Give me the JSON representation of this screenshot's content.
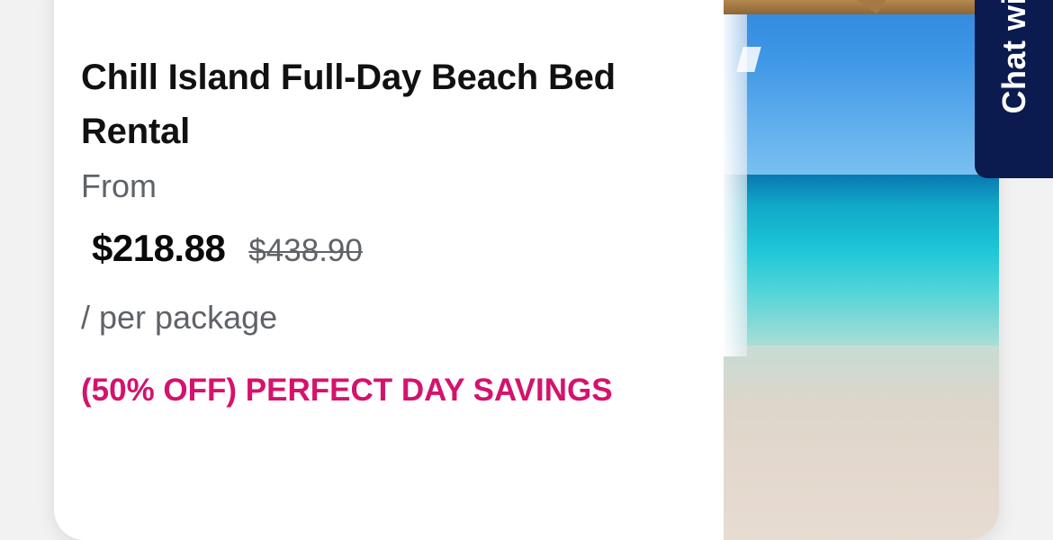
{
  "card": {
    "title": "Chill Island Full-Day Beach Bed Rental",
    "from_label": "From",
    "price": "$218.88",
    "original_price": "$438.90",
    "unit": "/ per package",
    "promo": "(50% OFF) PERFECT DAY SAVINGS",
    "promo_color": "#d5126c"
  },
  "chat_tab": {
    "label": "Chat with",
    "color": "#0c1b4f"
  },
  "icons": {
    "photo": "beach-photo"
  }
}
